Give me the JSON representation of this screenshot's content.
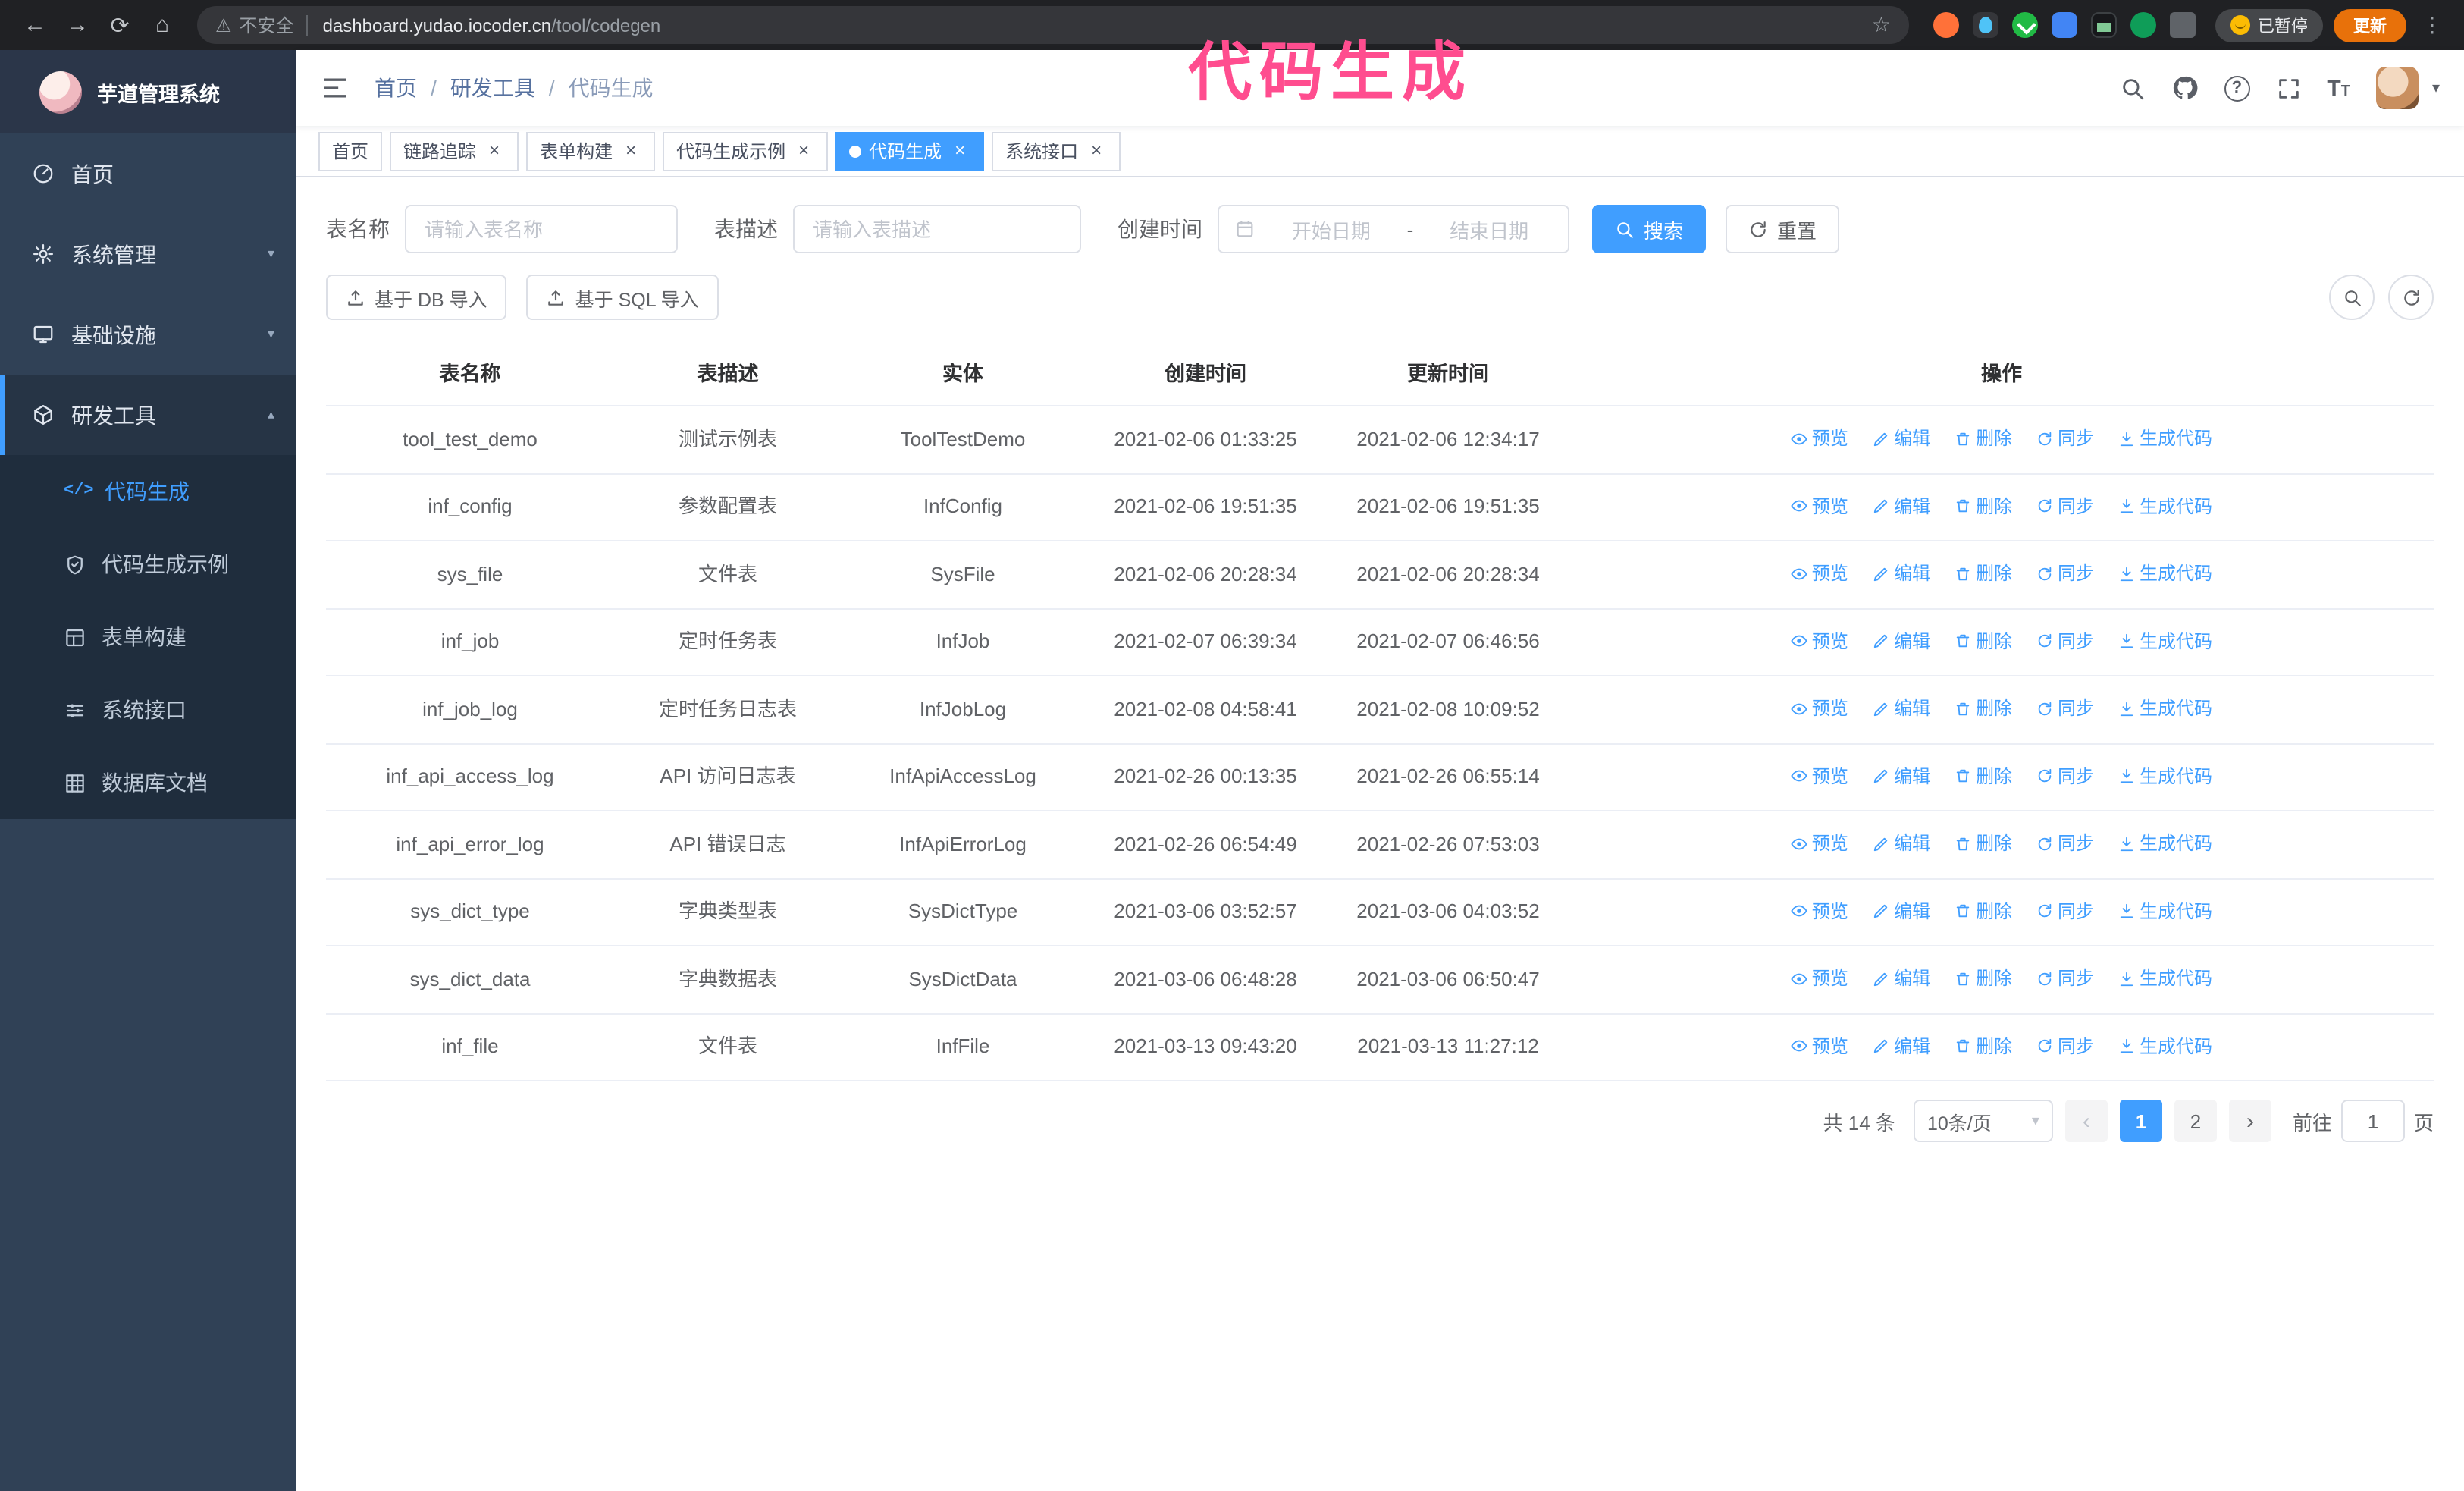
{
  "annotation": {
    "text": "代码生成"
  },
  "browser": {
    "back": "←",
    "forward": "→",
    "reload": "⟳",
    "home": "⌂",
    "warning": "⚠",
    "security_label": "不安全",
    "url_domain": "dashboard.yudao.iocoder.cn",
    "url_path": "/tool/codegen",
    "star": "☆",
    "paused_label": "已暂停",
    "update_label": "更新",
    "kebab": "⋮"
  },
  "sidebar": {
    "app_title": "芋道管理系统",
    "items": [
      {
        "label": "首页"
      },
      {
        "label": "系统管理"
      },
      {
        "label": "基础设施"
      },
      {
        "label": "研发工具"
      }
    ],
    "sub_items": [
      {
        "label": "代码生成"
      },
      {
        "label": "代码生成示例"
      },
      {
        "label": "表单构建"
      },
      {
        "label": "系统接口"
      },
      {
        "label": "数据库文档"
      }
    ]
  },
  "header": {
    "breadcrumb": {
      "home": "首页",
      "section": "研发工具",
      "current": "代码生成"
    },
    "separator": "/"
  },
  "tabs": [
    {
      "label": "首页"
    },
    {
      "label": "链路追踪"
    },
    {
      "label": "表单构建"
    },
    {
      "label": "代码生成示例"
    },
    {
      "label": "代码生成"
    },
    {
      "label": "系统接口"
    }
  ],
  "filters": {
    "name_label": "表名称",
    "name_placeholder": "请输入表名称",
    "desc_label": "表描述",
    "desc_placeholder": "请输入表描述",
    "time_label": "创建时间",
    "start_placeholder": "开始日期",
    "range_separator": "-",
    "end_placeholder": "结束日期",
    "search_label": "搜索",
    "reset_label": "重置"
  },
  "toolbar": {
    "import_db": "基于 DB 导入",
    "import_sql": "基于 SQL 导入"
  },
  "table": {
    "columns": [
      "表名称",
      "表描述",
      "实体",
      "创建时间",
      "更新时间",
      "操作"
    ],
    "actions": [
      "预览",
      "编辑",
      "删除",
      "同步",
      "生成代码"
    ],
    "rows": [
      {
        "name": "tool_test_demo",
        "desc": "测试示例表",
        "entity": "ToolTestDemo",
        "created": "2021-02-06 01:33:25",
        "updated": "2021-02-06 12:34:17"
      },
      {
        "name": "inf_config",
        "desc": "参数配置表",
        "entity": "InfConfig",
        "created": "2021-02-06 19:51:35",
        "updated": "2021-02-06 19:51:35"
      },
      {
        "name": "sys_file",
        "desc": "文件表",
        "entity": "SysFile",
        "created": "2021-02-06 20:28:34",
        "updated": "2021-02-06 20:28:34"
      },
      {
        "name": "inf_job",
        "desc": "定时任务表",
        "entity": "InfJob",
        "created": "2021-02-07 06:39:34",
        "updated": "2021-02-07 06:46:56"
      },
      {
        "name": "inf_job_log",
        "desc": "定时任务日志表",
        "entity": "InfJobLog",
        "created": "2021-02-08 04:58:41",
        "updated": "2021-02-08 10:09:52"
      },
      {
        "name": "inf_api_access_log",
        "desc": "API 访问日志表",
        "entity": "InfApiAccessLog",
        "created": "2021-02-26 00:13:35",
        "updated": "2021-02-26 06:55:14"
      },
      {
        "name": "inf_api_error_log",
        "desc": "API 错误日志",
        "entity": "InfApiErrorLog",
        "created": "2021-02-26 06:54:49",
        "updated": "2021-02-26 07:53:03"
      },
      {
        "name": "sys_dict_type",
        "desc": "字典类型表",
        "entity": "SysDictType",
        "created": "2021-03-06 03:52:57",
        "updated": "2021-03-06 04:03:52"
      },
      {
        "name": "sys_dict_data",
        "desc": "字典数据表",
        "entity": "SysDictData",
        "created": "2021-03-06 06:48:28",
        "updated": "2021-03-06 06:50:47"
      },
      {
        "name": "inf_file",
        "desc": "文件表",
        "entity": "InfFile",
        "created": "2021-03-13 09:43:20",
        "updated": "2021-03-13 11:27:12"
      }
    ]
  },
  "pagination": {
    "total": "共 14 条",
    "page_size": "10条/页",
    "prev": "‹",
    "next": "›",
    "pages": [
      "1",
      "2"
    ],
    "goto_label": "前往",
    "goto_value": "1",
    "goto_unit": "页"
  },
  "icons": {
    "close": "×",
    "chevron_down": "▾",
    "chevron_up": "▴",
    "caret_down": "▾",
    "question": "?",
    "code": "</>",
    "font_letter": "T"
  },
  "colors": {
    "accent": "#409eff",
    "sidebar_bg": "#304156",
    "annotation": "#ff4d8f"
  }
}
